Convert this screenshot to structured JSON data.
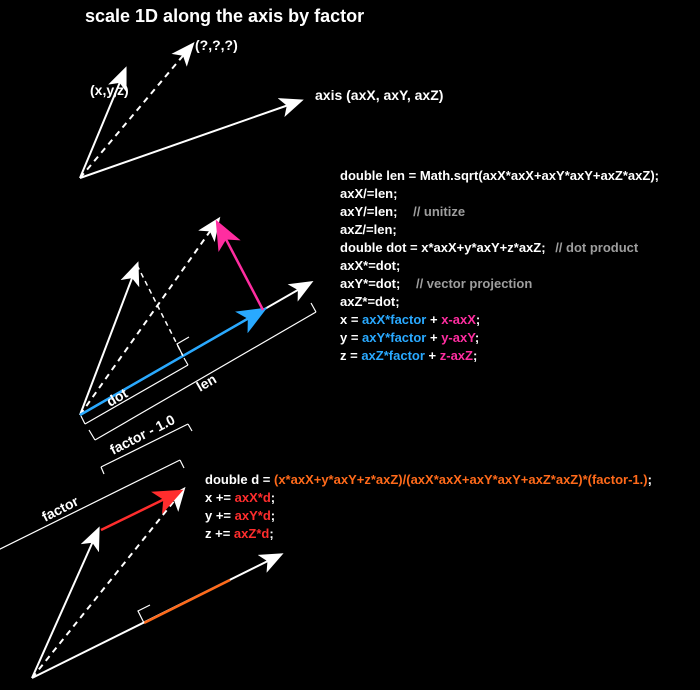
{
  "title": "scale 1D along the axis by factor",
  "labels": {
    "result": "(?,?,?)",
    "xyz": "(x,y,z)",
    "axis": "axis  (axX, axY, axZ)",
    "dot": "dot",
    "len": "len",
    "factor": "factor",
    "factor_minus_1": "factor - 1.0"
  },
  "code1": {
    "l1": "double len = Math.sqrt(axX*axX+axY*axY+axZ*axZ);",
    "l2": "axX/=len;",
    "l3": "axY/=len;",
    "l3c": "// unitize",
    "l4": "axZ/=len;",
    "l5": "double dot = x*axX+y*axY+z*axZ;",
    "l5c": "// dot product",
    "l6": "axX*=dot;",
    "l7": "axY*=dot;",
    "l7c": "// vector projection",
    "l8": "axZ*=dot;",
    "l9": "x = ",
    "l9b": "axX*factor",
    "l9p": " + ",
    "l9m": "x-axX",
    "l9e": ";",
    "l10": "y = ",
    "l10b": "axY*factor",
    "l10p": " + ",
    "l10m": "y-axY",
    "l10e": ";",
    "l11": "z = ",
    "l11b": "axZ*factor",
    "l11p": " + ",
    "l11m": "z-axZ",
    "l11e": ";"
  },
  "code2": {
    "l1": "double d = ",
    "l1o": "(x*axX+y*axY+z*axZ)/(axX*axX+axY*axY+axZ*axZ)*(factor-1.)",
    "l1e": ";",
    "l2": "x += ",
    "l2r": "axX*d",
    "l2e": ";",
    "l3": "y += ",
    "l3r": "axY*d",
    "l3e": ";",
    "l4": "z += ",
    "l4r": "axZ*d",
    "l4e": ";"
  }
}
